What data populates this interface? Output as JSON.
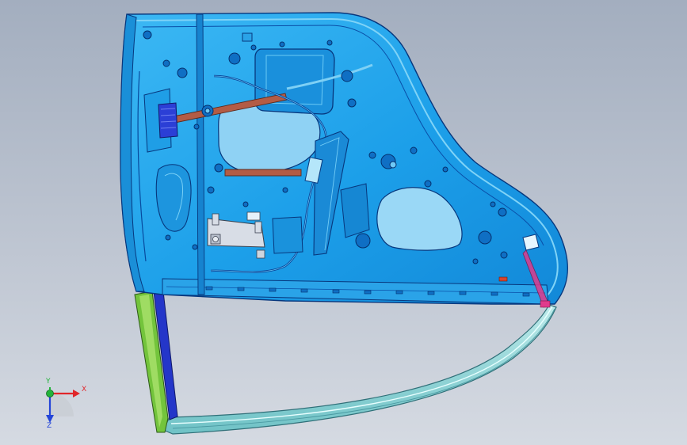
{
  "viewport": {
    "background_top": "#a3aebf",
    "background_bottom": "#d5dae2"
  },
  "model": {
    "panel_color": "#1fa6ee",
    "panel_dark": "#0b6fc4",
    "window_color": "#8fd2f4",
    "frame_color": "#8cd8d8",
    "pillar_color": "#6fbf3a",
    "channel_color": "#2033c8",
    "beam_color": "#b35c45",
    "accent_color": "#e03a8c"
  },
  "triad": {
    "x_label": "X",
    "y_label": "Y",
    "z_label": "Z",
    "x_color": "#e0262a",
    "y_color": "#22b33a",
    "z_color": "#2445d8"
  }
}
